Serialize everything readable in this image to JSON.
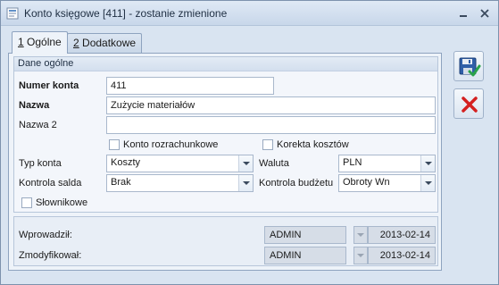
{
  "window": {
    "title": "Konto księgowe [411] - zostanie zmienione",
    "minimize_icon": "minimize-icon",
    "close_icon": "close-icon",
    "accent": "#1c62b9"
  },
  "tabs": [
    {
      "key": "1",
      "label": " Ogólne",
      "active": true
    },
    {
      "key": "2",
      "label": " Dodatkowe",
      "active": false
    }
  ],
  "general": {
    "section_title": "Dane ogólne",
    "numer_konta": {
      "label": "Numer konta",
      "value": "411"
    },
    "nazwa": {
      "label": "Nazwa",
      "value": "Zużycie materiałów"
    },
    "nazwa2": {
      "label": "Nazwa 2",
      "value": ""
    },
    "konto_rozrachunkowe": {
      "label": "Konto rozrachunkowe",
      "checked": false
    },
    "korekta_kosztow": {
      "label": "Korekta kosztów",
      "checked": false
    },
    "typ_konta": {
      "label": "Typ konta",
      "value": "Koszty"
    },
    "waluta": {
      "label": "Waluta",
      "value": "PLN"
    },
    "kontrola_salda": {
      "label": "Kontrola salda",
      "value": "Brak"
    },
    "kontrola_budzetu": {
      "label": "Kontrola budżetu",
      "value": "Obroty Wn"
    },
    "slownikowe": {
      "label": "Słownikowe",
      "checked": false
    }
  },
  "audit": {
    "wprowadzil": {
      "label": "Wprowadził:",
      "user": "ADMIN",
      "date": "2013-02-14"
    },
    "zmodyfikowal": {
      "label": "Zmodyfikował:",
      "user": "ADMIN",
      "date": "2013-02-14"
    }
  },
  "actions": {
    "save_icon": "save-icon",
    "cancel_icon": "cancel-icon"
  }
}
